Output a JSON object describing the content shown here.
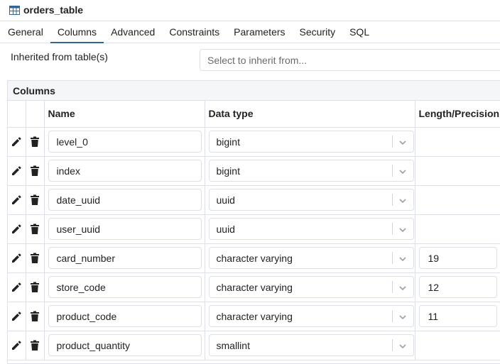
{
  "title": {
    "text": "orders_table",
    "icon": "table-icon"
  },
  "tabs": [
    {
      "label": "General",
      "active": false
    },
    {
      "label": "Columns",
      "active": true
    },
    {
      "label": "Advanced",
      "active": false
    },
    {
      "label": "Constraints",
      "active": false
    },
    {
      "label": "Parameters",
      "active": false
    },
    {
      "label": "Security",
      "active": false
    },
    {
      "label": "SQL",
      "active": false
    }
  ],
  "inherit": {
    "label": "Inherited from table(s)",
    "placeholder": "Select to inherit from..."
  },
  "columns_grid": {
    "caption": "Columns",
    "headers": {
      "name": "Name",
      "data_type": "Data type",
      "length": "Length/Precision"
    },
    "rows": [
      {
        "name": "level_0",
        "data_type": "bigint",
        "length": ""
      },
      {
        "name": "index",
        "data_type": "bigint",
        "length": ""
      },
      {
        "name": "date_uuid",
        "data_type": "uuid",
        "length": ""
      },
      {
        "name": "user_uuid",
        "data_type": "uuid",
        "length": ""
      },
      {
        "name": "card_number",
        "data_type": "character varying",
        "length": "19"
      },
      {
        "name": "store_code",
        "data_type": "character varying",
        "length": "12"
      },
      {
        "name": "product_code",
        "data_type": "character varying",
        "length": "11"
      },
      {
        "name": "product_quantity",
        "data_type": "smallint",
        "length": ""
      }
    ]
  },
  "colors": {
    "accent": "#326690",
    "border": "#dde0e6",
    "header_bg": "#f5f6f8"
  }
}
